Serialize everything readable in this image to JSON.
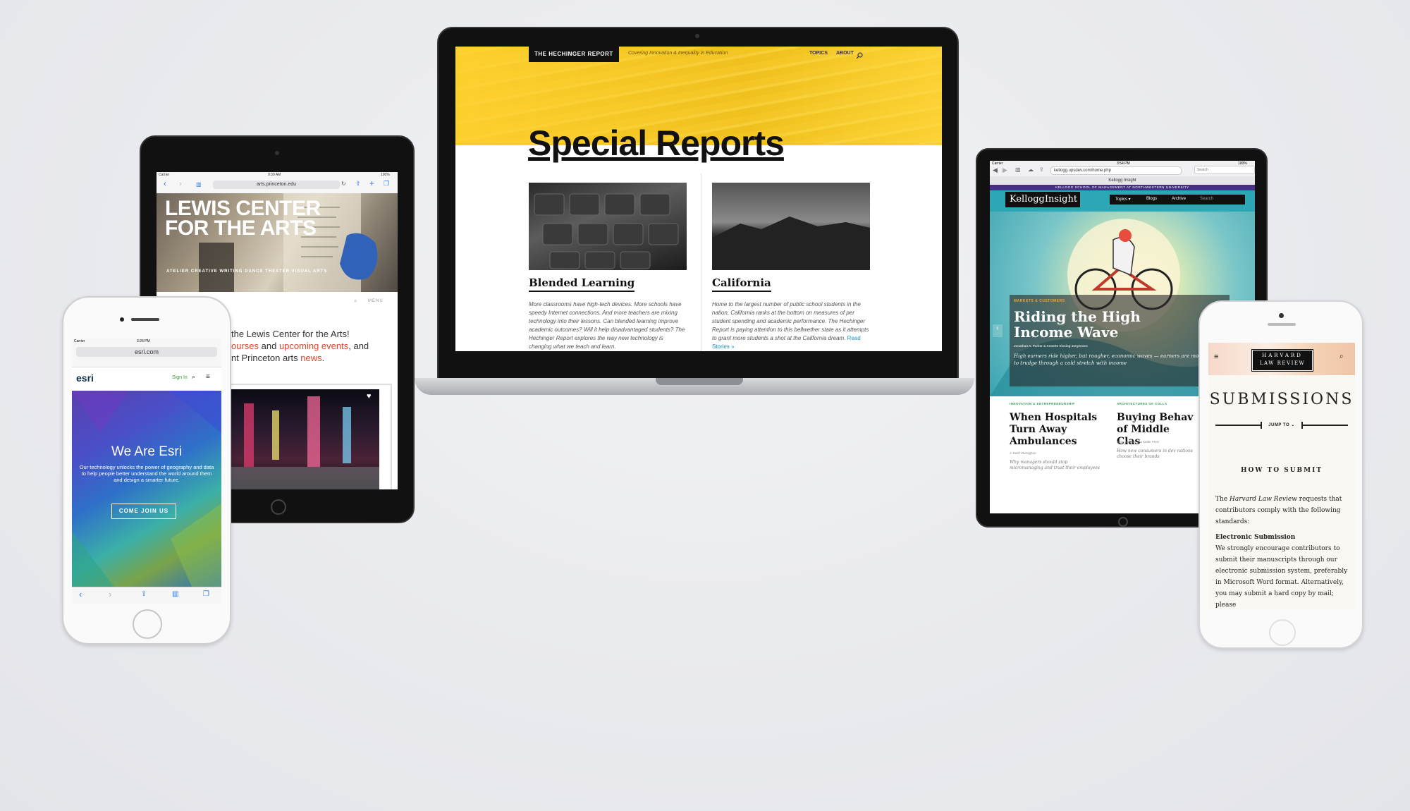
{
  "laptop": {
    "brand": "THE HECHINGER REPORT",
    "tagline": "Covering Innovation & Inequality in Education",
    "nav": [
      "TOPICS",
      "ABOUT"
    ],
    "title": "Special Reports",
    "cards": [
      {
        "title": "Blended Learning",
        "body": "More classrooms have high-tech devices. More schools have speedy Internet connections. And more teachers are mixing technology into their lessons. Can blended learning improve academic outcomes? Will it help disadvantaged students? The Hechinger Report explores the way new technology is changing what we teach and learn."
      },
      {
        "title": "California",
        "body": "Home to the largest number of public school students in the nation, California ranks at the bottom on measures of per student spending and academic performance. The Hechinger Report is paying attention to this bellwether state as it attempts to grant more students a shot at the California dream.",
        "link": "Read Stories »"
      }
    ]
  },
  "tablet_left": {
    "carrier": "Carrier",
    "time": "9:30 AM",
    "battery": "100%",
    "url": "arts.princeton.edu",
    "hero_title_1": "LEWIS CENTER",
    "hero_title_2": "FOR THE ARTS",
    "hero_sub": "ATELIER   CREATIVE WRITING   DANCE   THEATER   VISUAL ARTS",
    "menu": "MENU",
    "line1": "the Lewis Center for the Arts!",
    "line2_a": "ourses",
    "line2_b": " and ",
    "line2_c": "upcoming events",
    "line2_d": ", and",
    "line3_a": "nt Princeton arts ",
    "line3_b": "news",
    "line3_c": "."
  },
  "phone_left": {
    "carrier": "Carrier",
    "time": "3:26 PM",
    "url": "esri.com",
    "logo": "esri",
    "sign_in": "Sign In",
    "headline": "We Are Esri",
    "body": "Our technology unlocks the power of geography and data to help people better understand the world around them and design a smarter future.",
    "cta": "COME JOIN US"
  },
  "tablet_right": {
    "carrier": "Carrier",
    "time": "3:54 PM",
    "battery": "100%",
    "url": "kellogg.upsdev.com/home.php",
    "search_placeholder": "Search",
    "tab_title": "Kellogg Insight",
    "school_bar": "KELLOGG SCHOOL OF MANAGEMENT AT NORTHWESTERN UNIVERSITY",
    "logo": "KelloggInsight",
    "nav": [
      "Topics ▾",
      "Blogs",
      "Archive",
      "Search"
    ],
    "category": "MARKETS & CUSTOMERS",
    "headline": "Riding the High Income Wave",
    "authors": "Jonathan A. Parker & Annette Vissing-Jorgensen",
    "dek": "High earners ride higher, but rougher, economic waves — earners are more likely to trudge through a cold stretch with income",
    "stories": [
      {
        "category": "INNOVATION & ENTREPRENEURSHIP",
        "title": "When Hospitals Turn Away Ambulances",
        "author": "J. Keith Murnighan",
        "dek": "Why managers should stop micromanaging and trust their employees"
      },
      {
        "category": "ARCHITECTURES OF COLLA",
        "title": "Buying Behav of Middle Clas",
        "author": "Sean Sternberg & Kettle Fenn",
        "dek": "How new consumers in dev nations choose their brands"
      }
    ]
  },
  "phone_right": {
    "logo_1": "HARVARD",
    "logo_2": "LAW REVIEW",
    "title": "SUBMISSIONS",
    "jump": "JUMP TO ⌄",
    "section": "HOW TO SUBMIT",
    "intro_a": "The ",
    "intro_b": "Harvard Law Review",
    "intro_c": " requests that contributors comply with the following standards:",
    "sub_head": "Electronic Submission",
    "sub_body": "We strongly encourage contributors to submit their manuscripts through our electronic submission system, preferably in Microsoft Word format. Alternatively, you may submit a hard copy by mail; please"
  }
}
